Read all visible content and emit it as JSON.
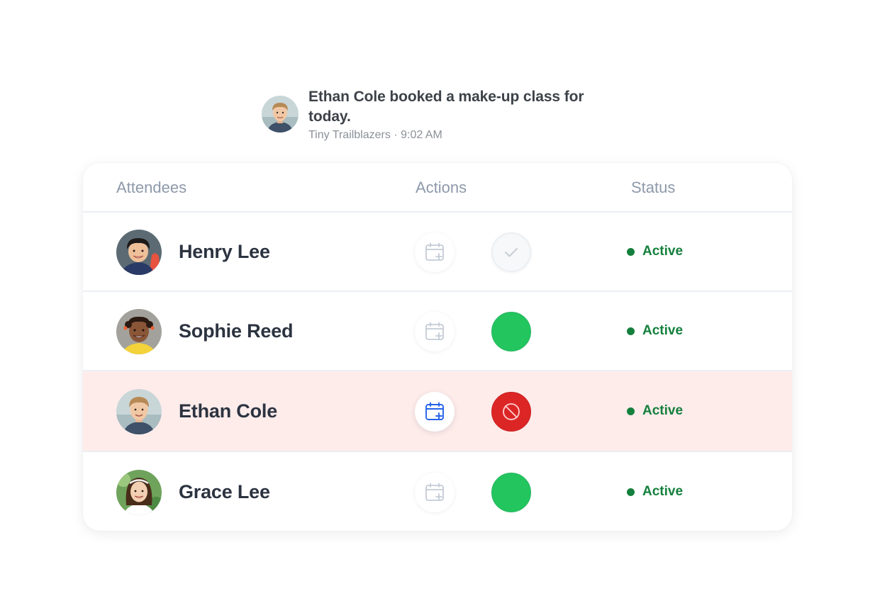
{
  "notification": {
    "message": "Ethan Cole booked a make-up class for today.",
    "meta": "Tiny Trailblazers · 9:02 AM",
    "avatar_icon": "child-avatar"
  },
  "table": {
    "headers": {
      "attendees": "Attendees",
      "actions": "Actions",
      "status": "Status"
    },
    "rows": [
      {
        "name": "Henry Lee",
        "status": "Active",
        "calendar_icon": "calendar-plus-icon",
        "state_icon": "check-icon",
        "state": "checked-muted"
      },
      {
        "name": "Sophie Reed",
        "status": "Active",
        "calendar_icon": "calendar-plus-icon",
        "state_icon": "green-circle",
        "state": "present"
      },
      {
        "name": "Ethan Cole",
        "status": "Active",
        "calendar_icon": "calendar-plus-icon",
        "state_icon": "ban-icon",
        "state": "absent",
        "highlighted": true
      },
      {
        "name": "Grace Lee",
        "status": "Active",
        "calendar_icon": "calendar-plus-icon",
        "state_icon": "green-circle",
        "state": "present"
      }
    ]
  },
  "colors": {
    "active_green": "#15803d",
    "present_green": "#22c55e",
    "absent_red": "#dc2626",
    "highlight_row": "#feeceb",
    "calendar_active_blue": "#2563eb",
    "calendar_muted": "#c4cbd6"
  }
}
